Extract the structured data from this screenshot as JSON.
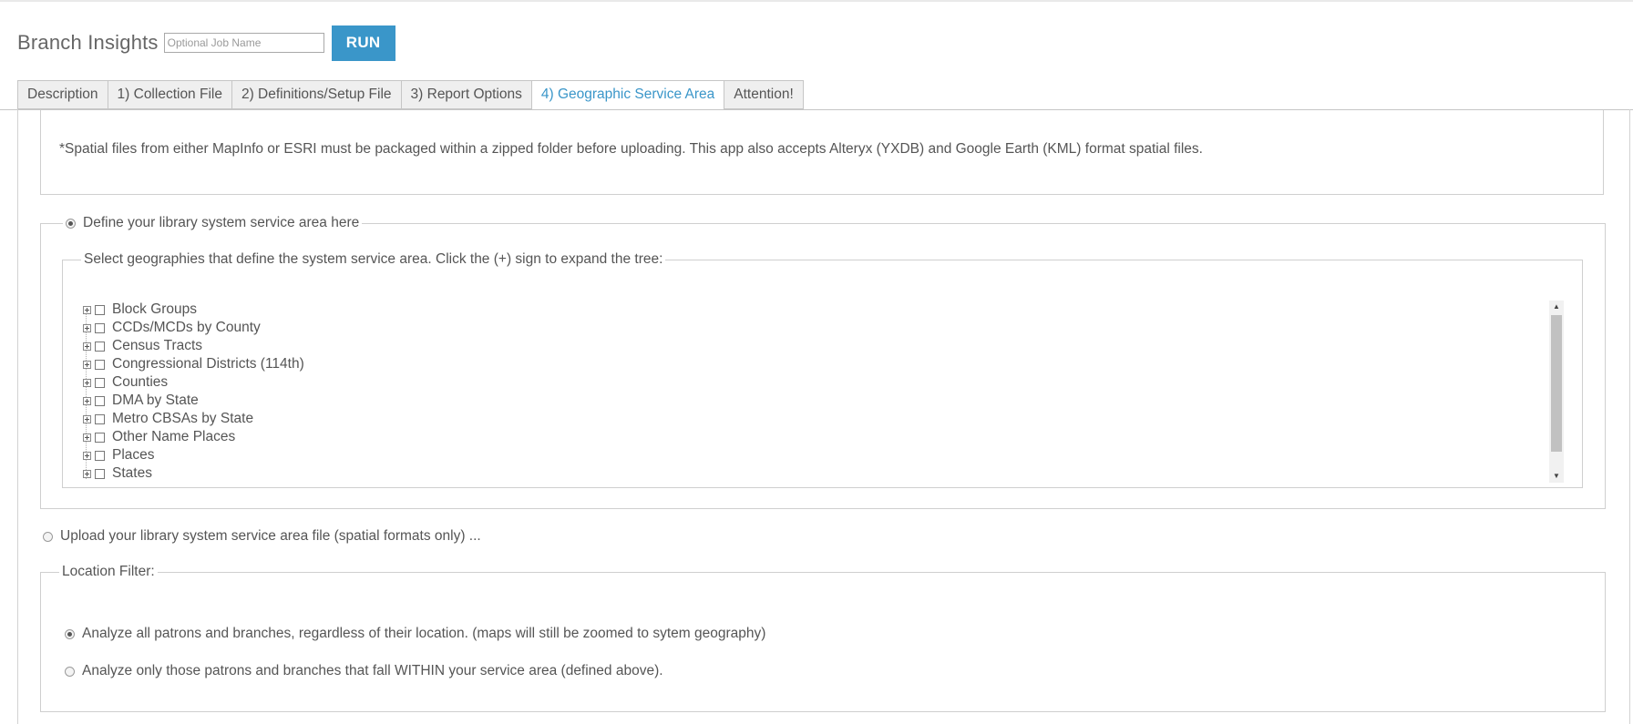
{
  "header": {
    "title": "Branch Insights",
    "job_name_placeholder": "Optional Job Name",
    "run_label": "RUN"
  },
  "tabs": [
    {
      "label": "Description",
      "active": false
    },
    {
      "label": "1) Collection File",
      "active": false
    },
    {
      "label": "2) Definitions/Setup File",
      "active": false
    },
    {
      "label": "3) Report Options",
      "active": false
    },
    {
      "label": "4) Geographic Service Area",
      "active": true
    },
    {
      "label": "Attention!",
      "active": false
    }
  ],
  "note": "*Spatial files from either MapInfo or ESRI must be packaged within a zipped folder before uploading. This app also accepts Alteryx (YXDB) and Google Earth (KML) format spatial files.",
  "define_area": {
    "label": "Define your library system service area here",
    "selected": true,
    "geography_legend": "Select geographies that define the system service area. Click the (+) sign to expand the tree:",
    "tree_items": [
      "Block Groups",
      "CCDs/MCDs by County",
      "Census Tracts",
      "Congressional Districts (114th)",
      "Counties",
      "DMA by State",
      "Metro CBSAs by State",
      "Other Name Places",
      "Places",
      "States"
    ]
  },
  "upload_area": {
    "label": "Upload your library system service area file (spatial formats only) ...",
    "selected": false
  },
  "location_filter": {
    "legend": "Location Filter:",
    "options": [
      {
        "label": "Analyze all patrons and branches, regardless of their location. (maps will still be zoomed to sytem geography)",
        "selected": true
      },
      {
        "label": "Analyze only those patrons and branches that fall WITHIN your service area (defined above).",
        "selected": false
      }
    ]
  },
  "icons": {
    "expander": "plus-box-icon",
    "scroll_up": "scroll-up-arrow-icon",
    "scroll_down": "scroll-down-arrow-icon"
  },
  "colors": {
    "accent": "#3a96c9",
    "text": "#555555",
    "border": "#cfcfcf"
  }
}
